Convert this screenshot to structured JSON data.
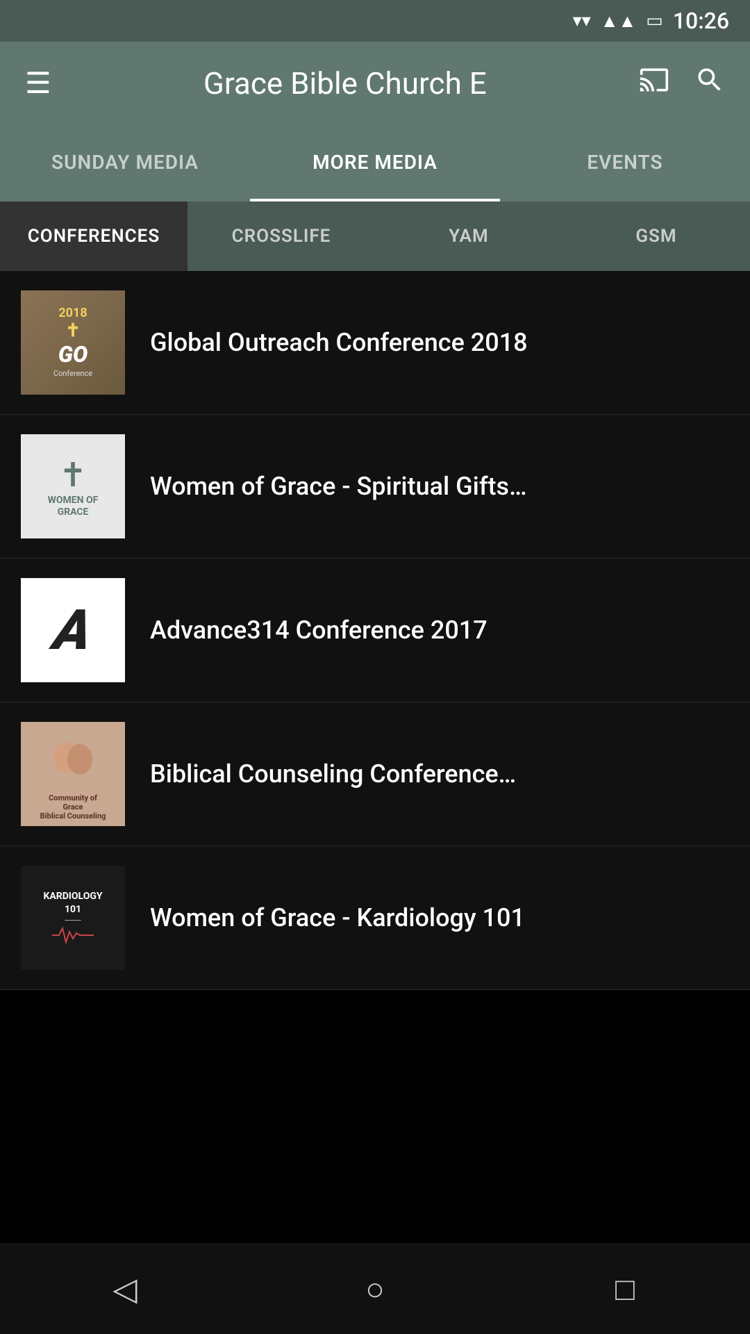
{
  "statusBar": {
    "time": "10:26"
  },
  "header": {
    "title": "Grace Bible Church E",
    "menuIcon": "☰",
    "castIcon": "⬜",
    "searchIcon": "🔍"
  },
  "mainTabs": [
    {
      "id": "sunday-media",
      "label": "SUNDAY MEDIA",
      "active": false
    },
    {
      "id": "more-media",
      "label": "MORE MEDIA",
      "active": true
    },
    {
      "id": "events",
      "label": "EVENTS",
      "active": false
    }
  ],
  "subTabs": [
    {
      "id": "conferences",
      "label": "CONFERENCES",
      "active": true
    },
    {
      "id": "crosslife",
      "label": "CROSSLIFE",
      "active": false
    },
    {
      "id": "yam",
      "label": "YAM",
      "active": false
    },
    {
      "id": "gsm",
      "label": "GSM",
      "active": false
    }
  ],
  "listItems": [
    {
      "id": "item-1",
      "title": "Global Outreach Conference 2018",
      "thumbType": "go"
    },
    {
      "id": "item-2",
      "title": "Women of Grace - Spiritual Gifts…",
      "thumbType": "wog"
    },
    {
      "id": "item-3",
      "title": "Advance314 Conference 2017",
      "thumbType": "adv"
    },
    {
      "id": "item-4",
      "title": "Biblical Counseling Conference…",
      "thumbType": "counsel"
    },
    {
      "id": "item-5",
      "title": "Women of Grace - Kardiology 101",
      "thumbType": "kard"
    }
  ],
  "bottomNav": {
    "back": "◁",
    "home": "○",
    "recent": "□"
  }
}
